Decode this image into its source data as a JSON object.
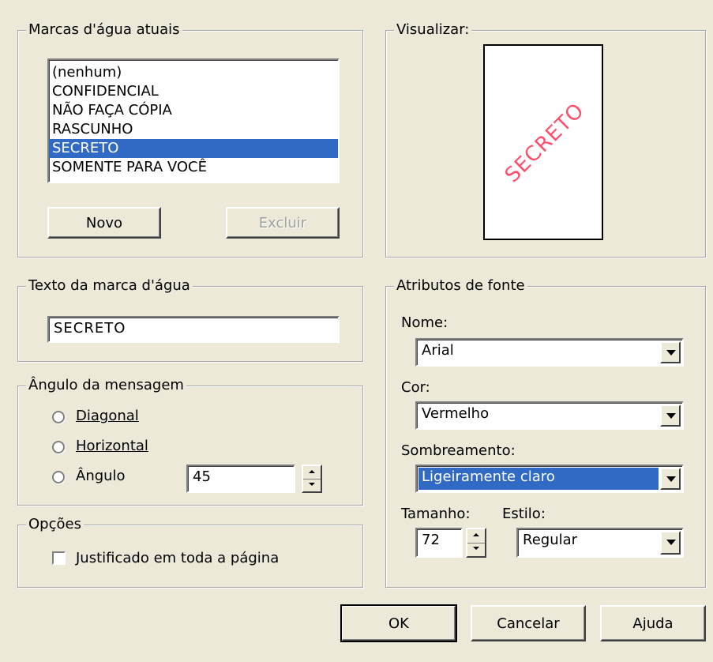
{
  "watermarks_group": {
    "title": "Marcas d'água atuais",
    "items": [
      "(nenhum)",
      "CONFIDENCIAL",
      "NÃO FAÇA CÓPIA",
      "RASCUNHO",
      "SECRETO",
      "SOMENTE PARA VOCÊ"
    ],
    "selected_index": 4,
    "new_label": "Novo",
    "delete_label": "Excluir"
  },
  "preview_group": {
    "title": "Visualizar:",
    "preview_text": "SECRETO",
    "preview_color": "#ff4d6d"
  },
  "text_group": {
    "title": "Texto da marca d'água",
    "value": "SECRETO"
  },
  "angle_group": {
    "title": "Ângulo da mensagem",
    "diagonal": "Diagonal",
    "horizontal": "Horizontal",
    "angle": "Ângulo",
    "angle_value": "45"
  },
  "options_group": {
    "title": "Opções",
    "justify_label": "Justificado em toda a página"
  },
  "font_group": {
    "title": "Atributos de fonte",
    "name_label": "Nome:",
    "name_value": "Arial",
    "color_label": "Cor:",
    "color_value": "Vermelho",
    "shading_label": "Sombreamento:",
    "shading_value": "Ligeiramente claro",
    "size_label": "Tamanho:",
    "size_value": "72",
    "style_label": "Estilo:",
    "style_value": "Regular"
  },
  "footer": {
    "ok_label": "OK",
    "cancel_label": "Cancelar",
    "help_label": "Ajuda"
  },
  "colors": {
    "dialog_bg": "#ece9d8",
    "selection": "#316ac5"
  }
}
